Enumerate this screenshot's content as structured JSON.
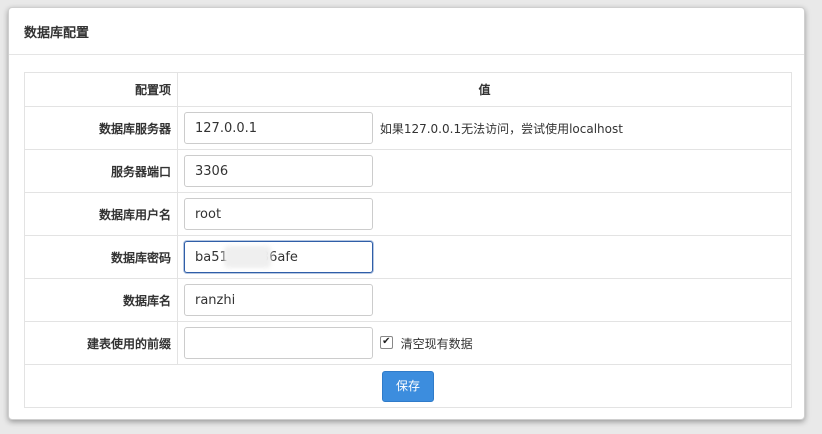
{
  "panel": {
    "title": "数据库配置"
  },
  "table": {
    "header_item": "配置项",
    "header_value": "值"
  },
  "rows": {
    "host": {
      "label": "数据库服务器",
      "value": "127.0.0.1",
      "hint": "如果127.0.0.1无法访问，尝试使用localhost"
    },
    "port": {
      "label": "服务器端口",
      "value": "3306"
    },
    "user": {
      "label": "数据库用户名",
      "value": "root"
    },
    "password": {
      "label": "数据库密码",
      "value": "ba51        36afe"
    },
    "dbname": {
      "label": "数据库名",
      "value": "ranzhi"
    },
    "prefix": {
      "label": "建表使用的前缀",
      "value": "",
      "checkbox_label": "清空现有数据",
      "checked": true
    }
  },
  "actions": {
    "save_label": "保存"
  },
  "colors": {
    "primary": "#3c8dde",
    "focus_border": "#2f5ea8"
  }
}
